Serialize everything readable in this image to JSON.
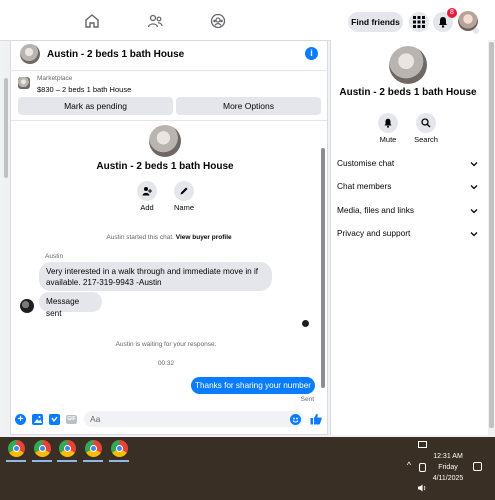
{
  "topbar": {
    "find_friends": "Find friends",
    "notification_count": "8"
  },
  "chat": {
    "header_title": "Austin - 2 beds 1 bath House",
    "marketplace_label": "Marketplace",
    "listing_line": "$830 – 2 beds 1 bath House",
    "mark_pending": "Mark as pending",
    "more_options": "More Options",
    "profile_title": "Austin - 2 beds 1 bath House",
    "add_label": "Add",
    "name_label": "Name",
    "started_text": "Austin started this chat.",
    "view_profile": "View buyer profile",
    "sender_name": "Austin",
    "message1": "Very interested in a walk through and immediate move in if available. 217-319-9943 -Austin",
    "message2": "Message sent",
    "waiting_text": "Austin is waiting for your response.",
    "timestamp": "00:32",
    "outgoing": "Thanks for sharing your number",
    "sent_label": "Sent",
    "composer_placeholder": "Aa"
  },
  "details": {
    "title": "Austin - 2 beds 1 bath House",
    "mute_label": "Mute",
    "search_label": "Search",
    "sections": [
      "Customise chat",
      "Chat members",
      "Media, files and links",
      "Privacy and support"
    ]
  },
  "taskbar": {
    "time": "12:31 AM",
    "day": "Friday",
    "date": "4/11/2025"
  },
  "colors": {
    "accent": "#0a7cff",
    "badge": "#e41e3f",
    "taskbar": "#3a2f24"
  }
}
